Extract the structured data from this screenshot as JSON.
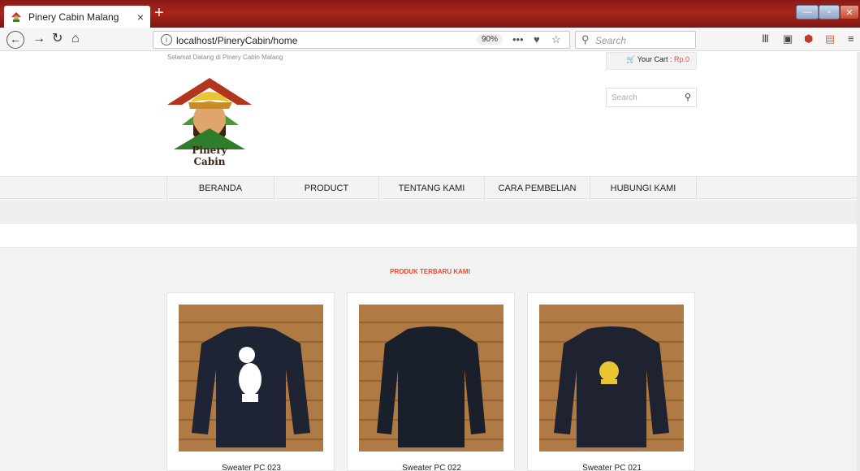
{
  "browser": {
    "tab_title": "Pinery Cabin Malang",
    "new_tab": "+",
    "close_tab": "×",
    "url": "localhost/PineryCabin/home",
    "zoom": "90%",
    "search_placeholder": "Search"
  },
  "site": {
    "welcome": "Selamat Datang di Pinery Cabin Malang",
    "cart_label": "Your Cart :",
    "cart_amount": "Rp.0",
    "search_placeholder": "Search",
    "logo_text_1": "Pinery",
    "logo_text_2": "Cabin",
    "menu": [
      "BERANDA",
      "PRODUCT",
      "TENTANG KAMI",
      "CARA PEMBELIAN",
      "HUBUNGI KAMI"
    ],
    "section_title": "PRODUK TERBARU KAMI",
    "products": [
      {
        "name": "Sweater PC 023"
      },
      {
        "name": "Sweater PC 022"
      },
      {
        "name": "Sweater PC 021"
      }
    ]
  },
  "colors": {
    "accent": "#e84b2d",
    "titlebar": "#a8251c"
  }
}
